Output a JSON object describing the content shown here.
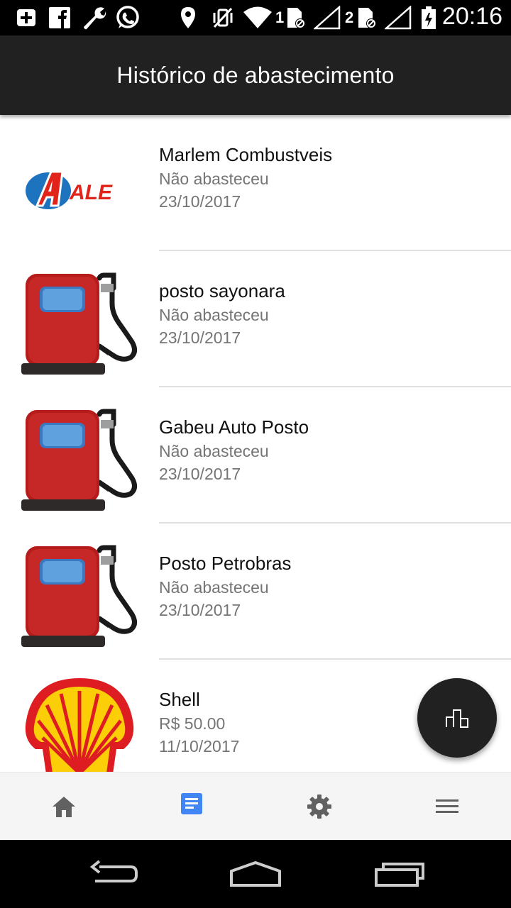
{
  "status_bar": {
    "time": "20:16",
    "sim1": "1",
    "sim2": "2",
    "icons": [
      "add-box-icon",
      "facebook-icon",
      "wrench-icon",
      "whatsapp-icon",
      "location-icon",
      "vibrate-off-icon",
      "wifi-icon",
      "sim-1-icon",
      "signal-1-icon",
      "sim-2-icon",
      "signal-2-icon",
      "battery-icon"
    ]
  },
  "app_bar": {
    "title": "Histórico de abastecimento"
  },
  "list": [
    {
      "name": "Marlem Combustveis",
      "status": "Não abasteceu",
      "date": "23/10/2017",
      "icon": "ale-logo"
    },
    {
      "name": "posto sayonara",
      "status": "Não abasteceu",
      "date": "23/10/2017",
      "icon": "fuel-pump-icon"
    },
    {
      "name": "Gabeu Auto Posto",
      "status": "Não abasteceu",
      "date": "23/10/2017",
      "icon": "fuel-pump-icon"
    },
    {
      "name": "Posto Petrobras",
      "status": "Não abasteceu",
      "date": "23/10/2017",
      "icon": "fuel-pump-icon"
    },
    {
      "name": "Shell",
      "status": "R$ 50.00",
      "date": "11/10/2017",
      "icon": "shell-logo"
    }
  ],
  "logos": {
    "ale_text": "ALE"
  },
  "fab": {
    "icon": "bar-chart-icon"
  },
  "bottom_nav": {
    "items": [
      {
        "icon": "home-icon",
        "active": false
      },
      {
        "icon": "history-icon",
        "active": true
      },
      {
        "icon": "settings-icon",
        "active": false
      },
      {
        "icon": "menu-icon",
        "active": false
      }
    ],
    "active_color": "#4285f4",
    "inactive_color": "#616161"
  },
  "system_nav": [
    "back-icon",
    "home-outline-icon",
    "recents-icon"
  ]
}
